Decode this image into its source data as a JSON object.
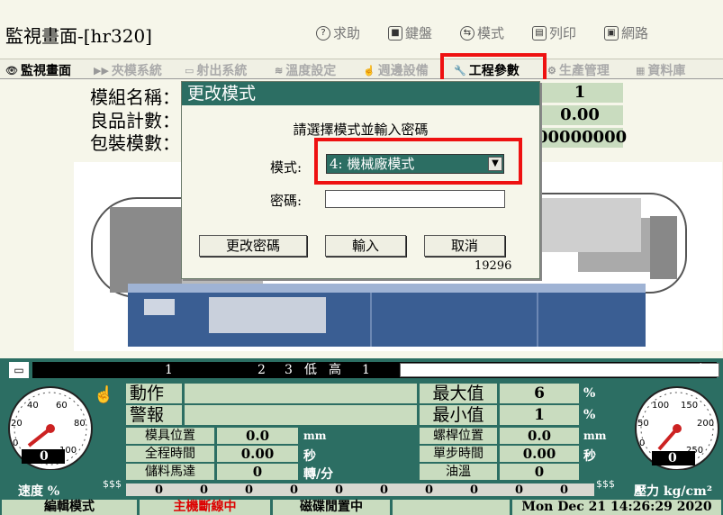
{
  "app": {
    "title": "監視畫面-[hr320]"
  },
  "toolbar": {
    "help": "求助",
    "keyboard": "鍵盤",
    "mode": "模式",
    "print": "列印",
    "network": "網路"
  },
  "tabs": [
    "監視畫面",
    "夾模系統",
    "射出系統",
    "溫度設定",
    "週邊設備",
    "工程參數",
    "生產管理",
    "資料庫"
  ],
  "info": {
    "mold_name_label": "模組名稱：",
    "mold_name_value": "1",
    "good_count_label": "良品計數：",
    "good_count_value": "0.00",
    "pack_count_label": "包裝模數：",
    "pack_count_value": "00000000"
  },
  "dialog": {
    "title": "更改模式",
    "prompt": "請選擇模式並輸入密碼",
    "mode_label": "模式:",
    "mode_value": "4: 機械廠模式",
    "password_label": "密碼:",
    "password_value": "",
    "btn_change_password": "更改密碼",
    "btn_enter": "輸入",
    "btn_cancel": "取消",
    "code": "19296"
  },
  "bar": {
    "n1": "1",
    "n2": "2",
    "n3": "3",
    "low": "低",
    "high": "高",
    "right_val": "1"
  },
  "left_gauge": {
    "ticks": [
      "40",
      "60",
      "20",
      "80",
      "0",
      "100"
    ],
    "value": "0",
    "label": "速度 %"
  },
  "right_gauge": {
    "ticks": [
      "100",
      "150",
      "50",
      "200",
      "0",
      "250"
    ],
    "value": "0",
    "label": "壓力 kg/cm²"
  },
  "panel": {
    "action_label": "動作",
    "alarm_label": "警報",
    "max_label": "最大值",
    "max_value": "6",
    "max_unit": "%",
    "min_label": "最小值",
    "min_value": "1",
    "min_unit": "%",
    "mold_pos_label": "模具位置",
    "mold_pos_value": "0.0",
    "mold_pos_unit": "mm",
    "cycle_time_label": "全程時間",
    "cycle_time_value": "0.00",
    "cycle_time_unit": "秒",
    "storage_motor_label": "儲料馬達",
    "storage_motor_value": "0",
    "storage_motor_unit": "轉/分",
    "screw_pos_label": "螺桿位置",
    "screw_pos_value": "0.0",
    "screw_pos_unit": "mm",
    "step_time_label": "單步時間",
    "step_time_value": "0.00",
    "step_time_unit": "秒",
    "oil_temp_label": "油溫",
    "oil_temp_value": "0"
  },
  "scale_values": [
    "0",
    "0",
    "0",
    "0",
    "0",
    "0",
    "0",
    "0",
    "0",
    "0"
  ],
  "status": {
    "mode": "編輯模式",
    "host": "主機斷線中",
    "disk": "磁碟閒置中",
    "datetime": "Mon Dec 21 14:26:29 2020"
  },
  "colors": {
    "teal": "#2c6e63",
    "light_green": "#c9dcbf",
    "highlight": "#e11111",
    "bg": "#f6f6ea"
  }
}
